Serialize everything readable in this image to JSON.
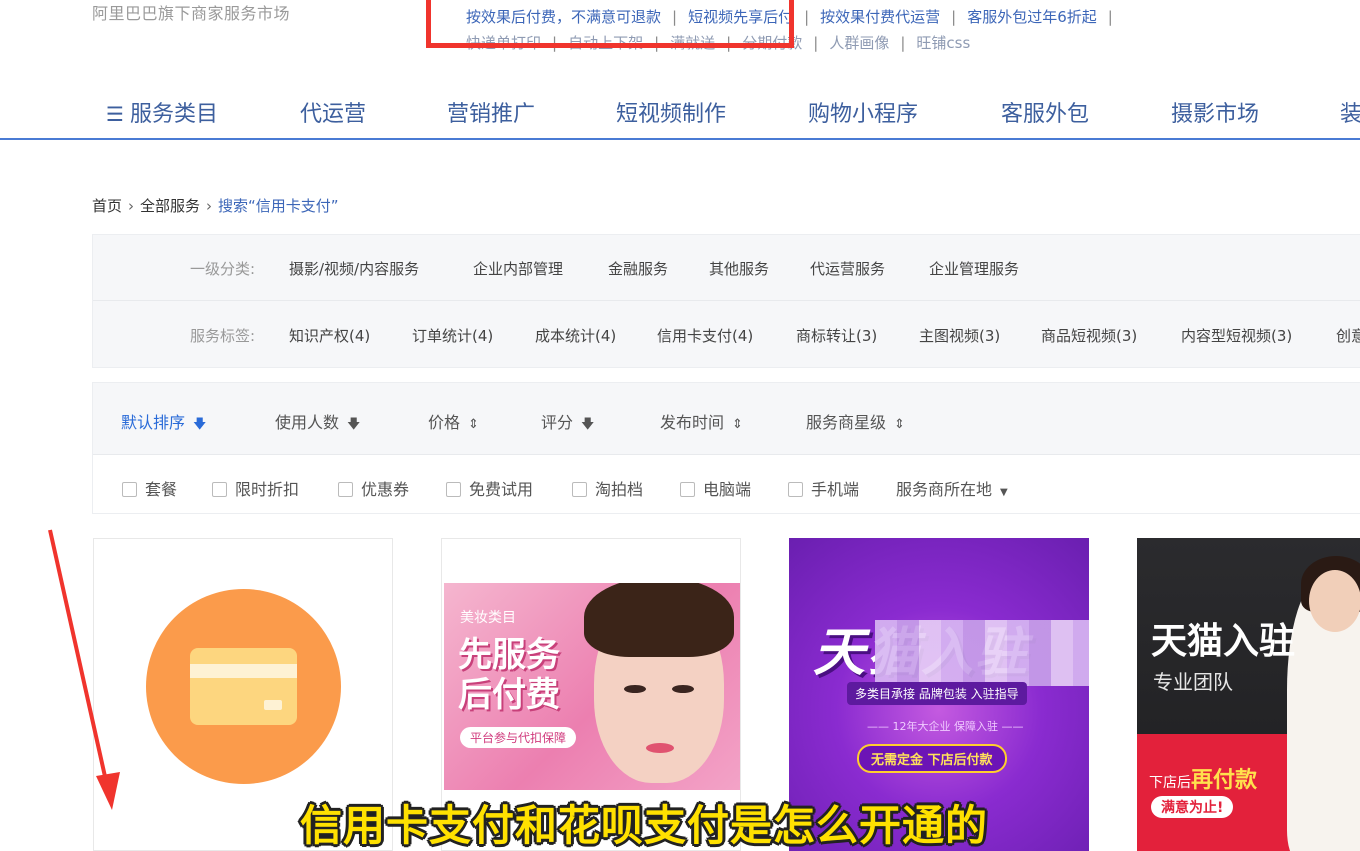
{
  "header": {
    "brand_sub": "阿里巴巴旗下商家服务市场",
    "promo_row1": [
      "按效果后付费，不满意可退款",
      "短视频先享后付",
      "按效果付费代运营",
      "客服外包过年6折起"
    ],
    "promo_row2": [
      "快递单打印",
      "自动上下架",
      "满就送",
      "分期付款",
      "人群画像",
      "旺铺css"
    ]
  },
  "nav": {
    "menu_icon": "menu-icon",
    "items": [
      "服务类目",
      "代运营",
      "营销推广",
      "短视频制作",
      "购物小程序",
      "客服外包",
      "摄影市场",
      "装"
    ]
  },
  "breadcrumb": {
    "home": "首页",
    "all": "全部服务",
    "current": "搜索“信用卡支付”"
  },
  "filters": {
    "category_label": "一级分类:",
    "categories": [
      "摄影/视频/内容服务",
      "企业内部管理",
      "金融服务",
      "其他服务",
      "代运营服务",
      "企业管理服务"
    ],
    "tags_label": "服务标签:",
    "tags": [
      "知识产权(4)",
      "订单统计(4)",
      "成本统计(4)",
      "信用卡支付(4)",
      "商标转让(3)",
      "主图视频(3)",
      "商品短视频(3)",
      "内容型短视频(3)",
      "创意"
    ]
  },
  "sort": {
    "items": [
      {
        "label": "默认排序",
        "icon": "arrow-down-icon",
        "glyph": "🡇"
      },
      {
        "label": "使用人数",
        "icon": "arrow-down-icon",
        "glyph": "🡇"
      },
      {
        "label": "价格",
        "icon": "sort-updown-icon",
        "glyph": "⇕"
      },
      {
        "label": "评分",
        "icon": "arrow-down-icon",
        "glyph": "🡇"
      },
      {
        "label": "发布时间",
        "icon": "sort-updown-icon",
        "glyph": "⇕"
      },
      {
        "label": "服务商星级",
        "icon": "sort-updown-icon",
        "glyph": "⇕"
      }
    ],
    "active_color": "#2a6bd8"
  },
  "checkboxes": {
    "items": [
      "套餐",
      "限时折扣",
      "优惠券",
      "免费试用",
      "淘拍档",
      "电脑端",
      "手机端"
    ],
    "location": "服务商所在地"
  },
  "cards": {
    "card2": {
      "cat": "美妆类目",
      "big1": "先服务",
      "big2": "后付费",
      "tag": "平台参与代扣保障"
    },
    "card3": {
      "title": "天猫入驻",
      "sub": "多类目承接 品牌包装 入驻指导",
      "sub2": "—— 12年大企业 保障入驻 ——",
      "pill": "无需定金 下店后付款"
    },
    "card4": {
      "title": "天猫入驻",
      "sub": "专业团队",
      "pay_prefix": "下店后",
      "pay_big": "再付款",
      "btn": "满意为止!"
    }
  },
  "subtitle": "信用卡支付和花呗支付是怎么开通的",
  "colors": {
    "nav_text": "#3d5f9e",
    "link_blue": "#3c66b8",
    "annotation_red": "#f0342d",
    "subtitle_yellow": "#ffe100"
  }
}
